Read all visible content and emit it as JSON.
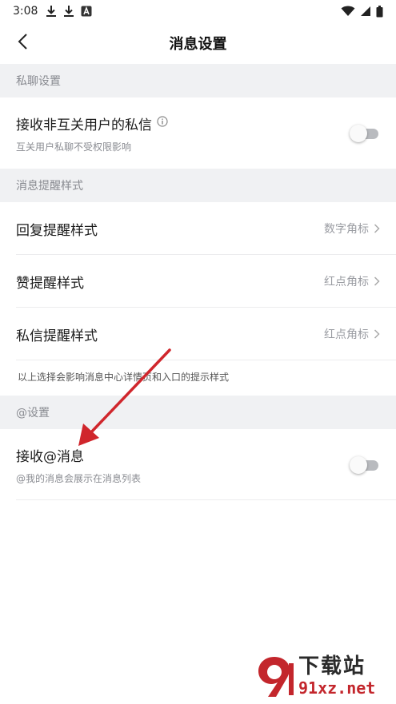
{
  "status_bar": {
    "time": "3:08",
    "left_icons": [
      "download-icon",
      "download-icon",
      "a-notification-icon"
    ],
    "right_icons": [
      "wifi-icon",
      "signal-icon",
      "battery-icon"
    ]
  },
  "header": {
    "title": "消息设置",
    "back_icon": "back-arrow-icon"
  },
  "sections": {
    "private_chat": {
      "header": "私聊设置",
      "rows": [
        {
          "title": "接收非互关用户的私信",
          "subtitle": "互关用户私聊不受权限影响",
          "has_info_icon": true,
          "toggle_on": false
        }
      ]
    },
    "reminder_style": {
      "header": "消息提醒样式",
      "rows": [
        {
          "title": "回复提醒样式",
          "value": "数字角标"
        },
        {
          "title": "赞提醒样式",
          "value": "红点角标"
        },
        {
          "title": "私信提醒样式",
          "value": "红点角标"
        }
      ],
      "note": "以上选择会影响消息中心详情页和入口的提示样式"
    },
    "at_settings": {
      "header": "@设置",
      "rows": [
        {
          "title": "接收@消息",
          "subtitle": "@我的消息会展示在消息列表",
          "toggle_on": false
        }
      ]
    }
  },
  "watermark": {
    "title": "下载站",
    "url": "91xz.net"
  },
  "colors": {
    "section_bg": "#f0f1f3",
    "toggle_off_track": "#b9bbbf",
    "annotation_arrow": "#d0262c",
    "watermark_red": "#c3262c"
  }
}
